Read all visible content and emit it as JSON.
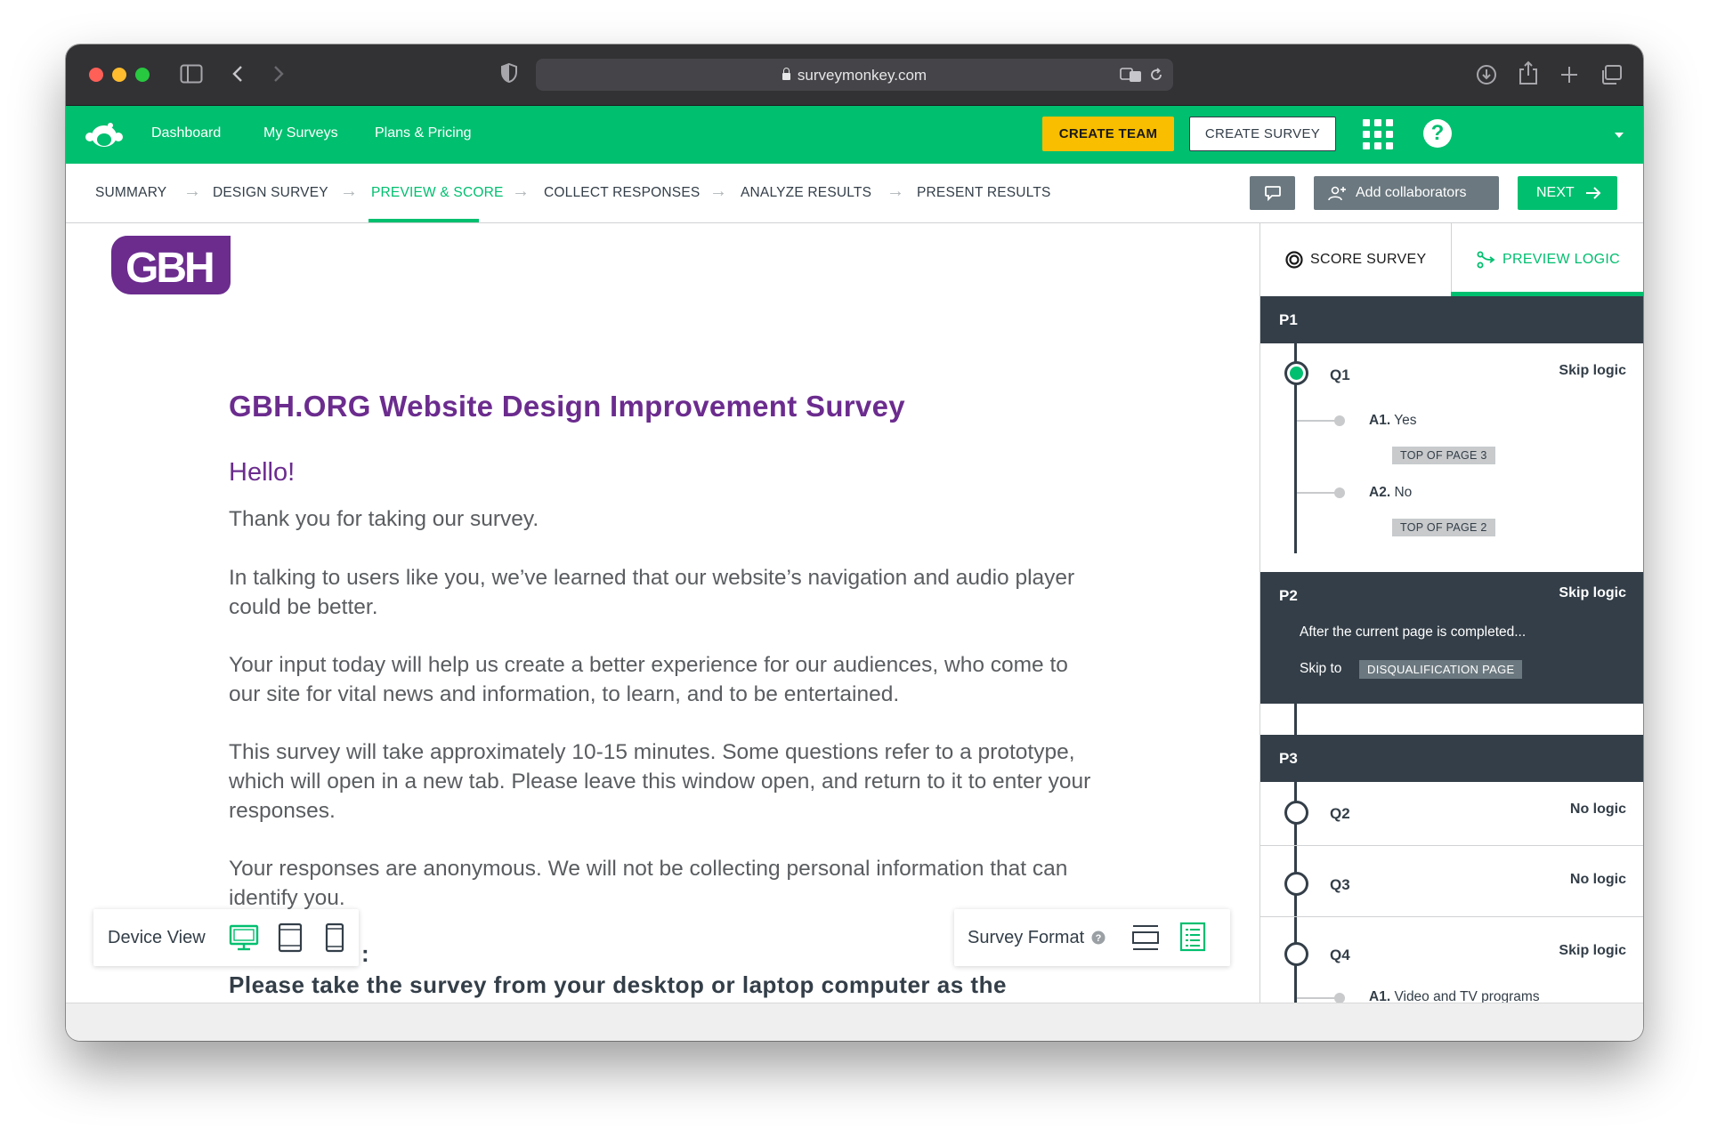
{
  "browser": {
    "url": "surveymonkey.com"
  },
  "topnav": {
    "links": [
      "Dashboard",
      "My Surveys",
      "Plans & Pricing"
    ],
    "create_team": "CREATE TEAM",
    "create_survey": "CREATE SURVEY",
    "help": "?"
  },
  "steps": [
    {
      "label": "SUMMARY"
    },
    {
      "label": "DESIGN SURVEY"
    },
    {
      "label": "PREVIEW & SCORE"
    },
    {
      "label": "COLLECT RESPONSES"
    },
    {
      "label": "ANALYZE RESULTS"
    },
    {
      "label": "PRESENT RESULTS"
    }
  ],
  "actions": {
    "collaborators": "Add collaborators",
    "next": "NEXT"
  },
  "survey": {
    "logo": "GBH",
    "title": "GBH.ORG Website Design Improvement Survey",
    "greeting": "Hello!",
    "paragraphs": [
      "Thank you for taking our survey.",
      "In talking to users like you, we’ve learned that our website’s navigation and audio player could be better.",
      "Your input today will help us create a better experience for our audiences, who come to our site for vital news and information, to learn, and to be entertained.",
      "This survey will take approximately 10-15 minutes. Some questions refer to a prototype, which will open in a new tab. Please leave this window open, and return to it to enter your responses.",
      "Your responses are anonymous. We will not be collecting personal information that can identify you."
    ],
    "colon": ":",
    "bold_line": "Please take the survey from your desktop or laptop computer as the"
  },
  "device_view": {
    "label": "Device View"
  },
  "survey_format": {
    "label": "Survey Format"
  },
  "panel": {
    "tabs": {
      "score": "SCORE SURVEY",
      "logic": "PREVIEW LOGIC"
    },
    "p1": {
      "name": "P1",
      "q1": {
        "name": "Q1",
        "logic": "Skip logic",
        "answers": [
          {
            "prefix": "A1.",
            "text": "Yes",
            "target": "TOP OF PAGE 3"
          },
          {
            "prefix": "A2.",
            "text": "No",
            "target": "TOP OF PAGE 2"
          }
        ]
      }
    },
    "p2": {
      "name": "P2",
      "logic": "Skip logic",
      "condition": "After the current page is completed...",
      "skip_to": "Skip to",
      "target": "DISQUALIFICATION PAGE"
    },
    "p3": {
      "name": "P3",
      "questions": [
        {
          "name": "Q2",
          "logic": "No logic"
        },
        {
          "name": "Q3",
          "logic": "No logic"
        },
        {
          "name": "Q4",
          "logic": "Skip logic",
          "first_answer_prefix": "A1.",
          "first_answer": "Video and TV programs"
        }
      ]
    }
  },
  "colors": {
    "brand_green": "#00bf6f",
    "create_team_yellow": "#f9be00",
    "survey_purple": "#6b2c8e",
    "dark_slate": "#333e48"
  }
}
